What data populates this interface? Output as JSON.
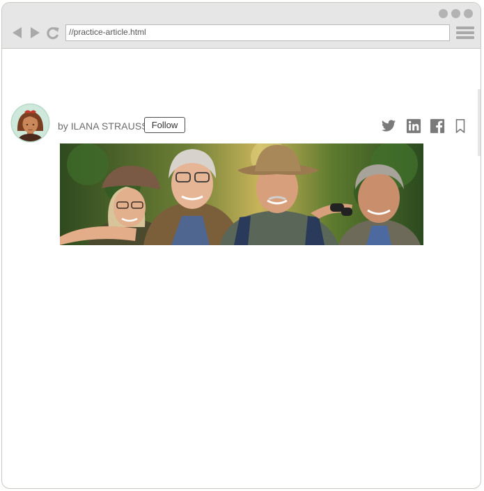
{
  "browser": {
    "url": "//practice-article.html",
    "icons": [
      "back-arrow-icon",
      "forward-arrow-icon",
      "reload-icon",
      "hamburger-menu-icon"
    ]
  },
  "article": {
    "byline_prefix": "by",
    "author": "ILANA STRAUSS",
    "follow_label": "Follow",
    "share_icons": [
      "twitter-icon",
      "linkedin-icon",
      "facebook-icon",
      "bookmark-icon"
    ]
  },
  "colors": {
    "chrome": "#e6e6e6",
    "icon_gray": "#7a7a7a",
    "byline": "#6c6c6c"
  }
}
